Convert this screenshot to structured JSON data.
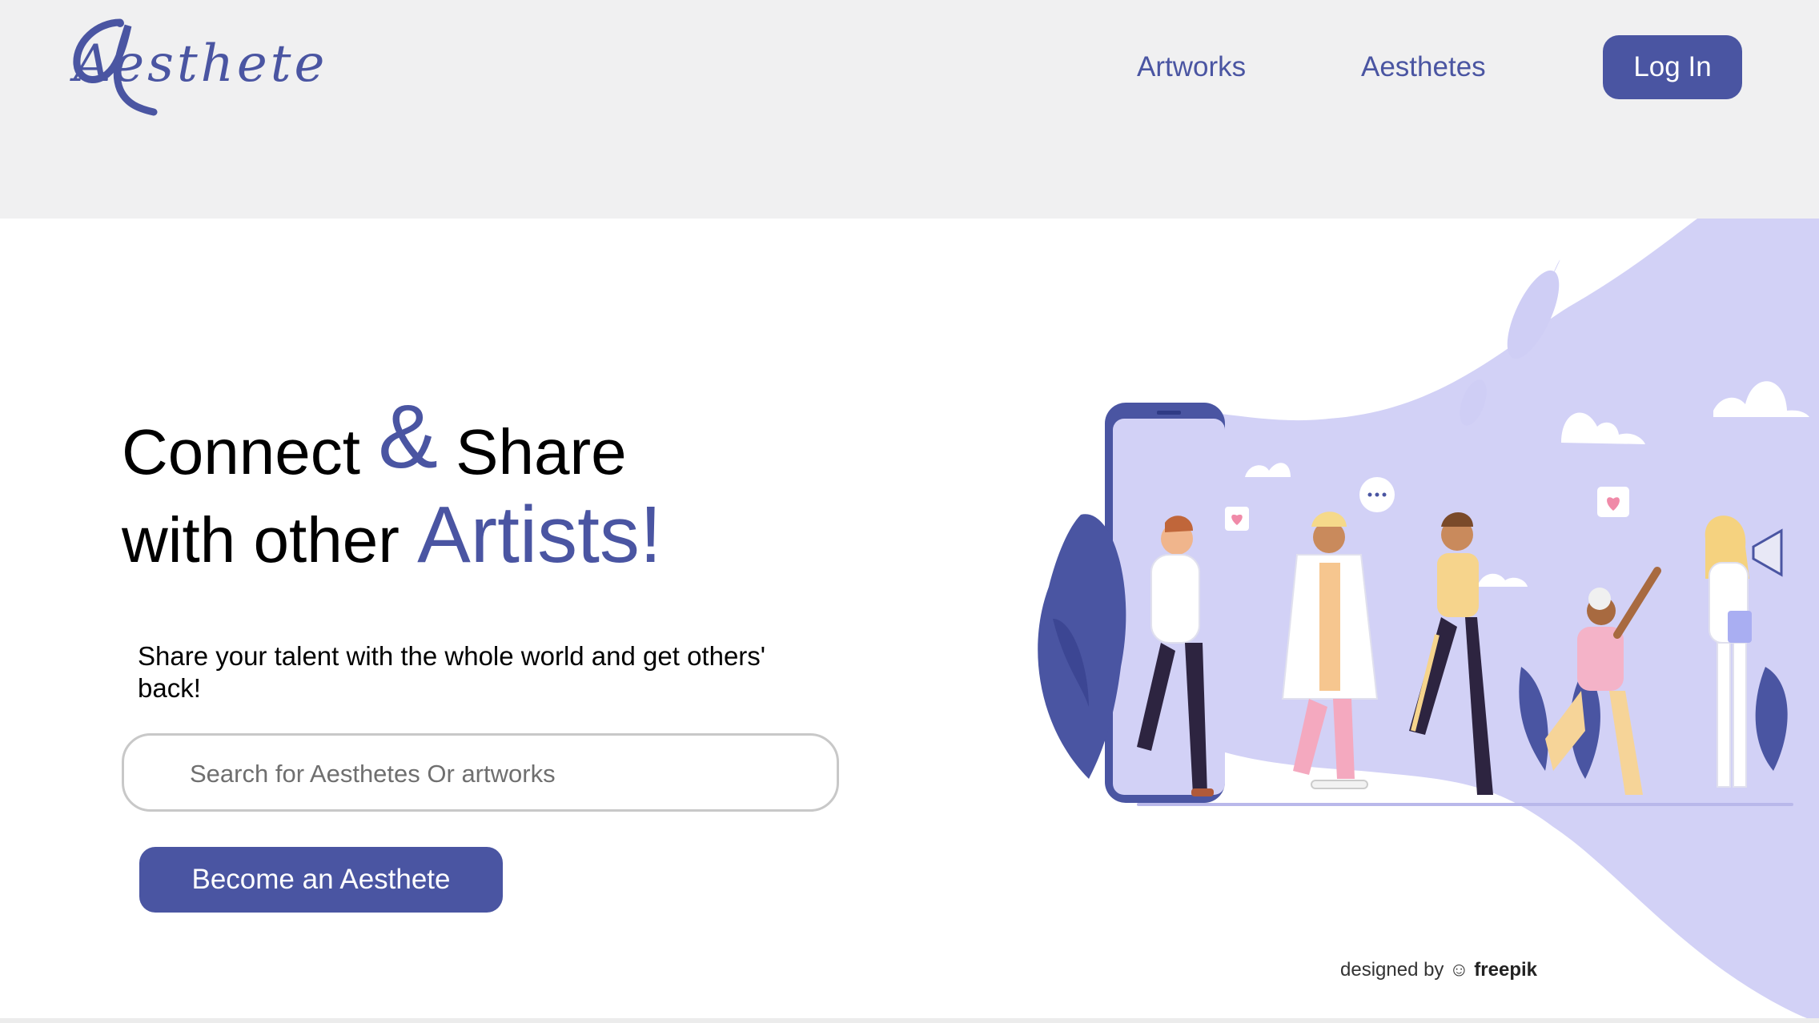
{
  "header": {
    "logo_text": "Aesthete",
    "nav": {
      "artworks": "Artworks",
      "aesthetes": "Aesthetes"
    },
    "login_label": "Log In"
  },
  "hero": {
    "line1_a": "Connect ",
    "line1_amp": "&",
    "line1_b": " Share",
    "line2_a": "with other ",
    "line2_accent": "Artists!",
    "subtitle": "Share your talent with the whole world and get others' back!",
    "search_placeholder": "Search for Aesthetes Or artworks",
    "cta_label": "Become an Aesthete"
  },
  "illustration": {
    "credit_prefix": "designed by",
    "credit_brand": "freepik"
  },
  "colors": {
    "brand": "#4a55a2",
    "header_bg": "#f0f0f1",
    "blob": "#d2d1f6"
  },
  "icons": [
    "logo-mark-icon",
    "freepik-icon",
    "heart-bubble-icon",
    "chat-dots-icon",
    "cloud-icon",
    "megaphone-icon",
    "phone-icon"
  ]
}
